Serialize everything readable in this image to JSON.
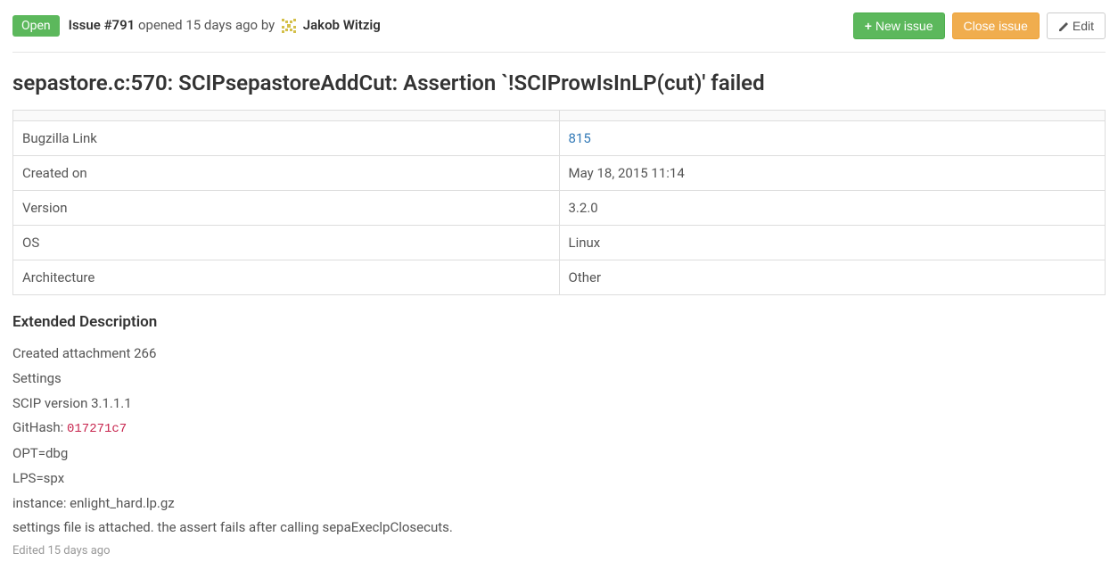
{
  "header": {
    "status": "Open",
    "issue_number": "Issue #791",
    "opened_text": " opened 15 days ago by ",
    "author": "Jakob Witzig"
  },
  "actions": {
    "new_issue": "New issue",
    "close_issue": "Close issue",
    "edit": "Edit"
  },
  "title": "sepastore.c:570: SCIPsepastoreAddCut: Assertion `!SCIProwIsInLP(cut)' failed",
  "details": {
    "rows": [
      {
        "label": "Bugzilla Link",
        "value": "815",
        "is_link": true
      },
      {
        "label": "Created on",
        "value": "May 18, 2015 11:14",
        "is_link": false
      },
      {
        "label": "Version",
        "value": "3.2.0",
        "is_link": false
      },
      {
        "label": "OS",
        "value": "Linux",
        "is_link": false
      },
      {
        "label": "Architecture",
        "value": "Other",
        "is_link": false
      }
    ]
  },
  "extended": {
    "heading": "Extended Description",
    "lines": {
      "l0": "Created attachment 266",
      "l1": "Settings",
      "l2": "SCIP version 3.1.1.1",
      "l3_prefix": "GitHash: ",
      "l3_code": "017271c7",
      "l4": "OPT=dbg",
      "l5": "LPS=spx",
      "l6": "instance: enlight_hard.lp.gz",
      "l7": "settings file is attached. the assert fails after calling sepaExeclpClosecuts."
    },
    "edited": "Edited 15 days ago"
  }
}
